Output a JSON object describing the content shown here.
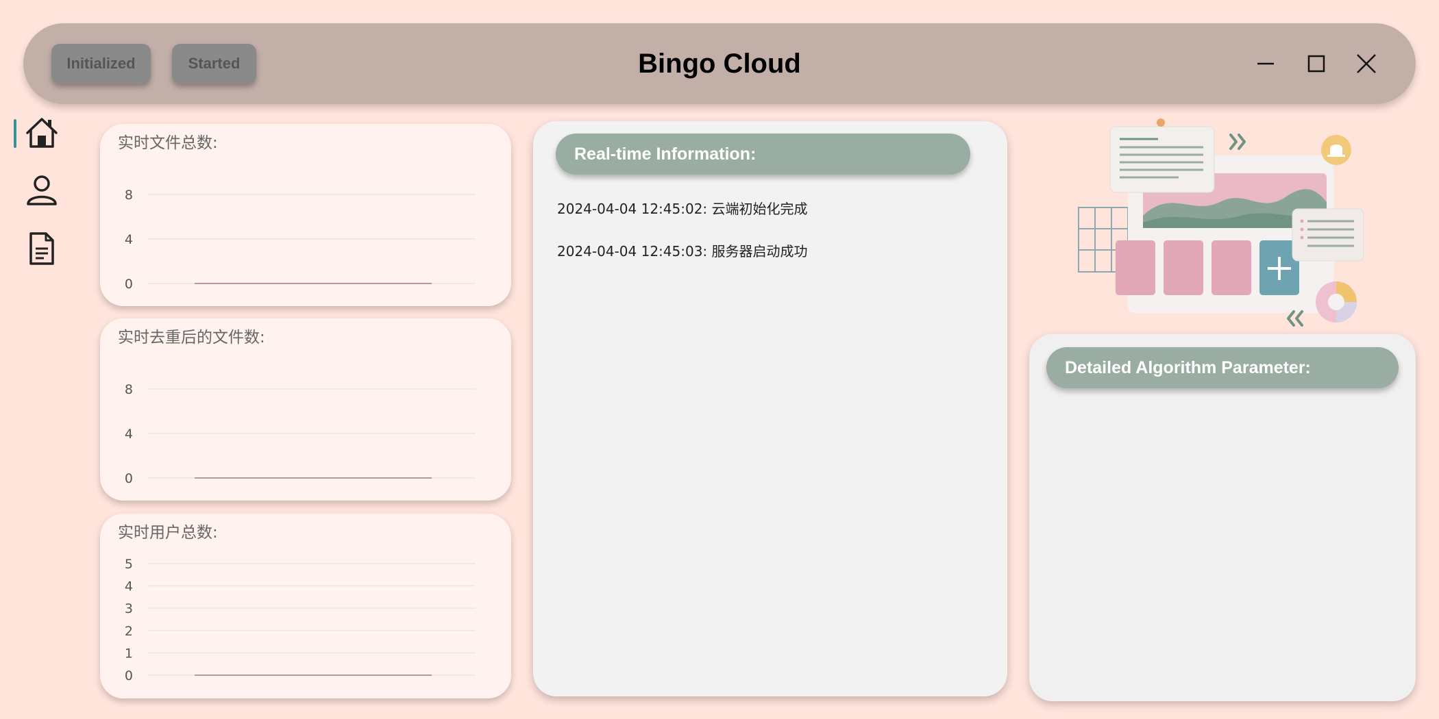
{
  "header": {
    "title": "Bingo Cloud",
    "status_buttons": [
      "Initialized",
      "Started"
    ]
  },
  "sidebar": {
    "items": [
      {
        "icon": "home-icon",
        "active": true
      },
      {
        "icon": "user-icon",
        "active": false
      },
      {
        "icon": "document-icon",
        "active": false
      }
    ]
  },
  "charts": {
    "files_total": {
      "title": "实时文件总数:"
    },
    "dedup_files": {
      "title": "实时去重后的文件数:"
    },
    "users_total": {
      "title": "实时用户总数:"
    }
  },
  "chart_data": [
    {
      "type": "line",
      "title": "实时文件总数:",
      "yticks": [
        "0",
        "4",
        "8"
      ],
      "ylim": [
        0,
        8
      ],
      "values": [
        0,
        0
      ]
    },
    {
      "type": "line",
      "title": "实时去重后的文件数:",
      "yticks": [
        "0",
        "4",
        "8"
      ],
      "ylim": [
        0,
        8
      ],
      "values": [
        0,
        0
      ]
    },
    {
      "type": "line",
      "title": "实时用户总数:",
      "yticks": [
        "0",
        "1",
        "2",
        "3",
        "4",
        "5"
      ],
      "ylim": [
        0,
        5
      ],
      "values": [
        0,
        0
      ]
    }
  ],
  "info": {
    "header": "Real-time Information:",
    "logs": [
      "2024-04-04 12:45:02:  云端初始化完成",
      "2024-04-04 12:45:03:  服务器启动成功"
    ]
  },
  "params": {
    "header": "Detailed Algorithm Parameter:"
  },
  "colors": {
    "background": "#ffe4dc",
    "titlebar": "#c2afa8",
    "pill_header": "#99ada3",
    "accent": "#3c8f95",
    "line": "#b49a90"
  }
}
